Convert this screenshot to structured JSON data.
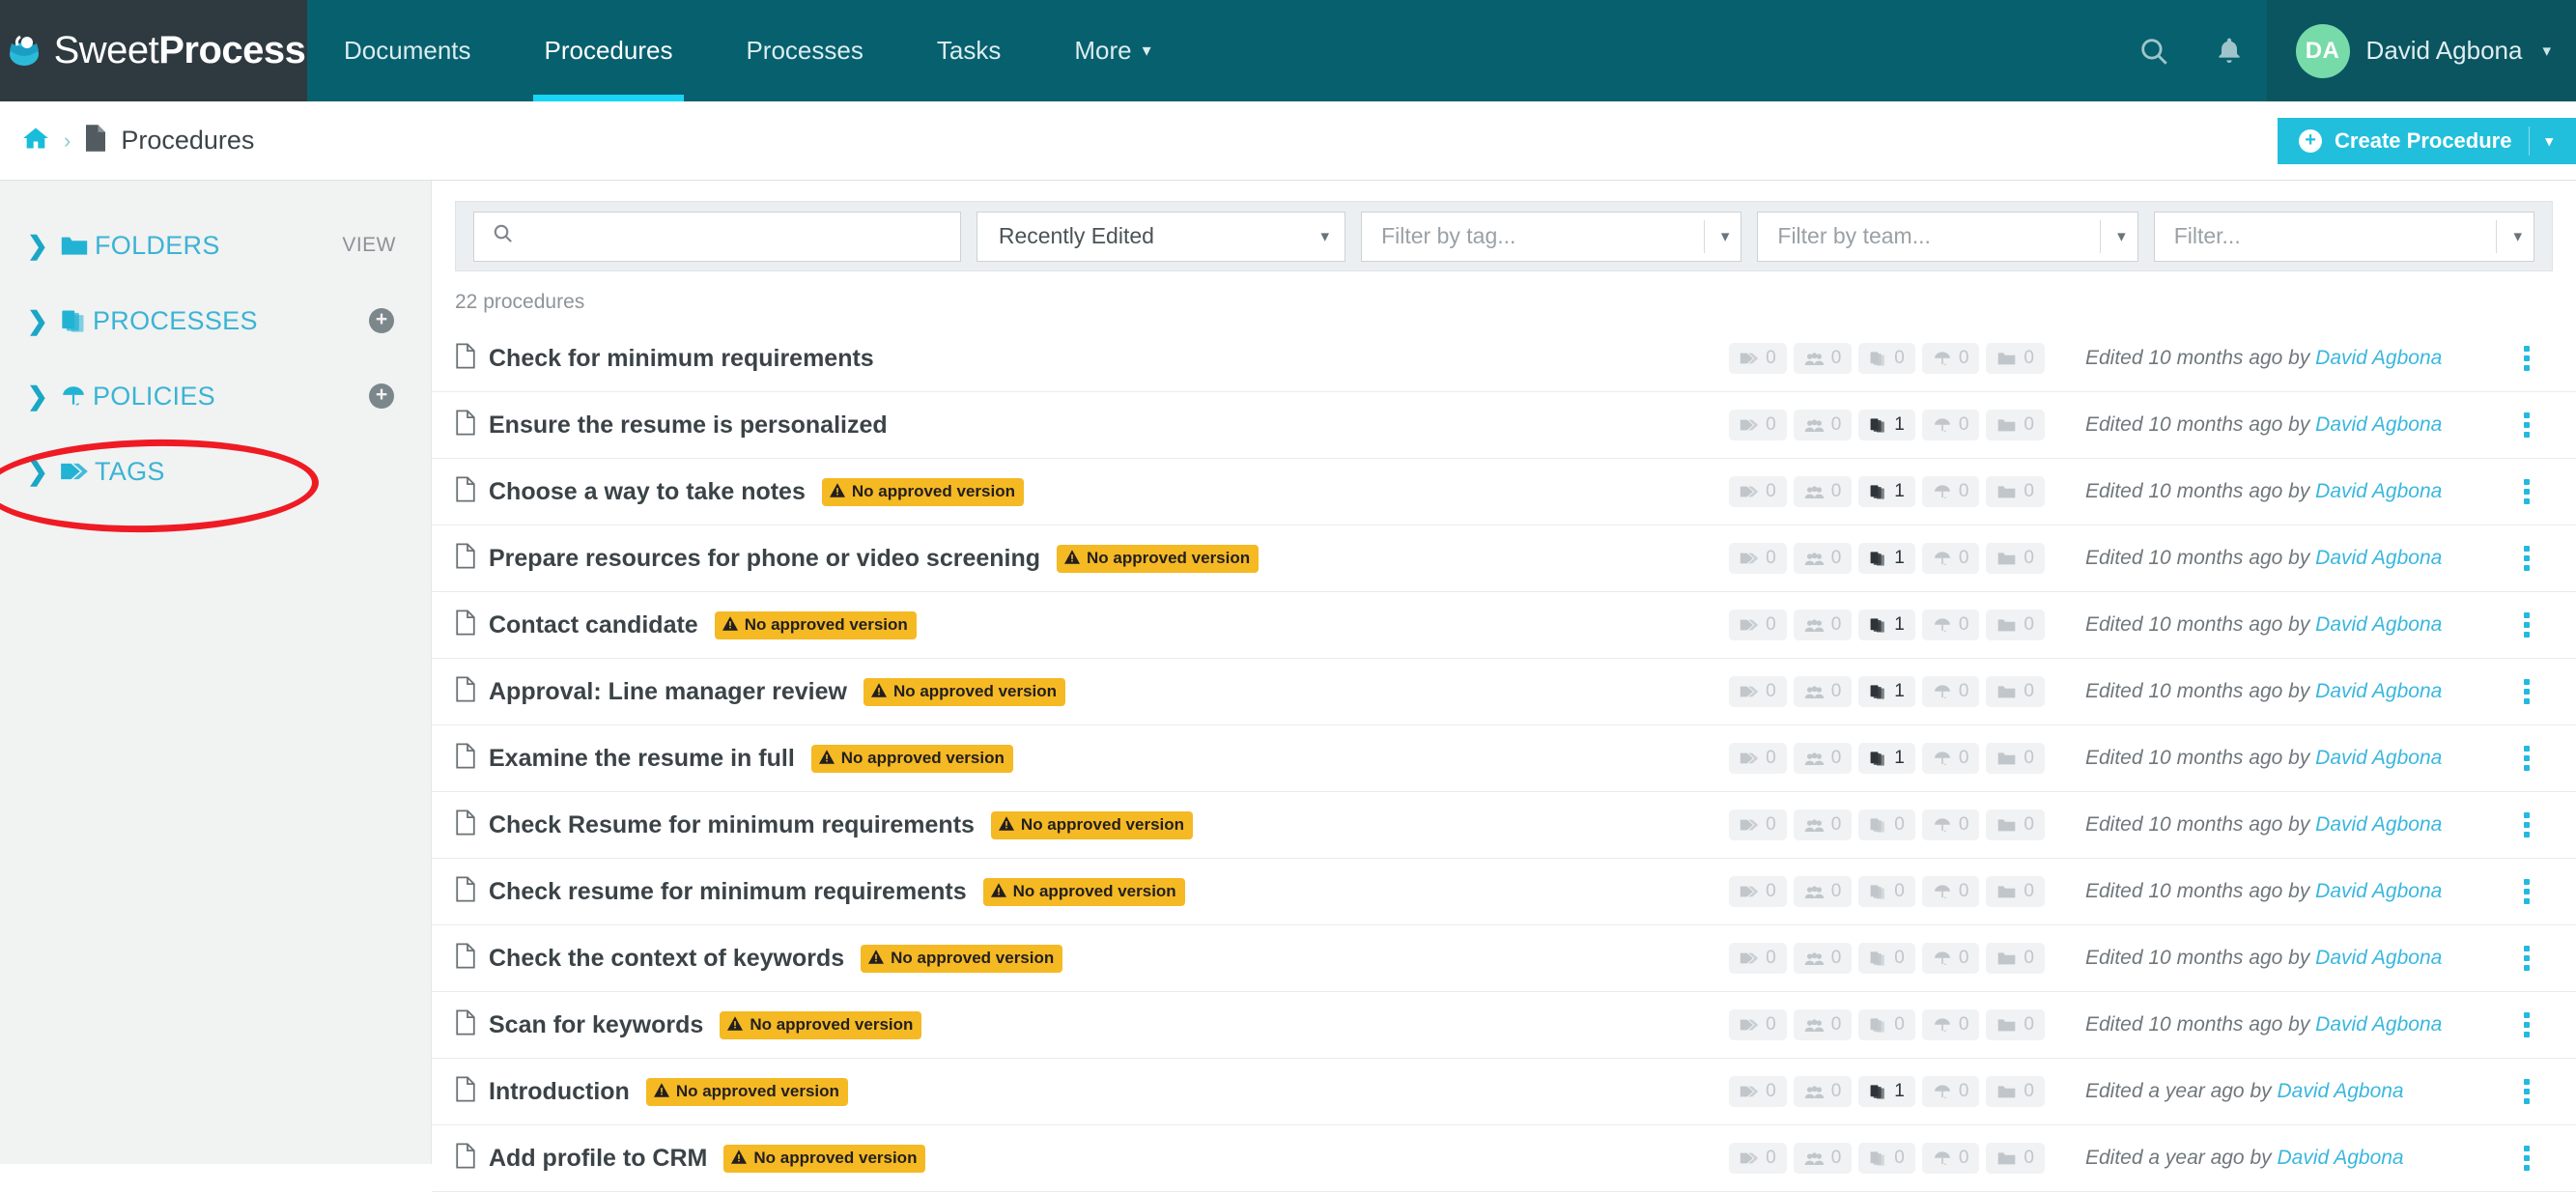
{
  "header": {
    "logo_light": "Sweet",
    "logo_bold": "Process",
    "nav": [
      {
        "label": "Documents",
        "active": false
      },
      {
        "label": "Procedures",
        "active": true
      },
      {
        "label": "Processes",
        "active": false
      },
      {
        "label": "Tasks",
        "active": false
      },
      {
        "label": "More",
        "active": false,
        "caret": "⌄"
      }
    ],
    "search_icon": "search-icon",
    "bell_icon": "bell-icon",
    "user": {
      "initials": "DA",
      "name": "David Agbona",
      "caret": "⌄"
    },
    "accent_teal": "#06606e",
    "accent_cyan": "#19d5f5"
  },
  "breadcrumb": {
    "home_icon": "home-icon",
    "separator": "›",
    "page_icon": "document-icon",
    "label": "Procedures"
  },
  "create_button": {
    "label": "Create Procedure",
    "plus": "+",
    "caret": "▾",
    "color": "#22bfdd"
  },
  "sidebar": {
    "items": [
      {
        "label": "FOLDERS",
        "icon": "folder-icon",
        "action": "VIEW",
        "action_type": "text"
      },
      {
        "label": "PROCESSES",
        "icon": "processes-icon",
        "action": "+",
        "action_type": "plus",
        "annotated": true
      },
      {
        "label": "POLICIES",
        "icon": "umbrella-icon",
        "action": "+",
        "action_type": "plus"
      },
      {
        "label": "TAGS",
        "icon": "tag-icon",
        "action": "",
        "action_type": "none"
      }
    ],
    "annotation_color": "#ee1b24"
  },
  "filters": {
    "search_placeholder": "",
    "search_icon": "search-icon",
    "sort_value": "Recently Edited",
    "tag_placeholder": "Filter by tag...",
    "team_placeholder": "Filter by team...",
    "other_placeholder": "Filter..."
  },
  "list": {
    "count_label": "22 procedures",
    "badge_text": "No approved version",
    "stat_icons": [
      "tag-icon",
      "team-icon",
      "processes-icon",
      "policy-icon",
      "folder-icon"
    ],
    "rows": [
      {
        "name": "Check for minimum requirements",
        "badge": false,
        "stats": [
          0,
          0,
          0,
          0,
          0
        ],
        "edited": "Edited 10 months ago by ",
        "by": "David Agbona"
      },
      {
        "name": "Ensure the resume is personalized",
        "badge": false,
        "stats": [
          0,
          0,
          1,
          0,
          0
        ],
        "edited": "Edited 10 months ago by ",
        "by": "David Agbona"
      },
      {
        "name": "Choose a way to take notes",
        "badge": true,
        "stats": [
          0,
          0,
          1,
          0,
          0
        ],
        "edited": "Edited 10 months ago by ",
        "by": "David Agbona"
      },
      {
        "name": "Prepare resources for phone or video screening",
        "badge": true,
        "stats": [
          0,
          0,
          1,
          0,
          0
        ],
        "edited": "Edited 10 months ago by ",
        "by": "David Agbona"
      },
      {
        "name": "Contact candidate",
        "badge": true,
        "stats": [
          0,
          0,
          1,
          0,
          0
        ],
        "edited": "Edited 10 months ago by ",
        "by": "David Agbona"
      },
      {
        "name": "Approval: Line manager review",
        "badge": true,
        "stats": [
          0,
          0,
          1,
          0,
          0
        ],
        "edited": "Edited 10 months ago by ",
        "by": "David Agbona"
      },
      {
        "name": "Examine the resume in full",
        "badge": true,
        "stats": [
          0,
          0,
          1,
          0,
          0
        ],
        "edited": "Edited 10 months ago by ",
        "by": "David Agbona"
      },
      {
        "name": "Check Resume for minimum requirements",
        "badge": true,
        "stats": [
          0,
          0,
          0,
          0,
          0
        ],
        "edited": "Edited 10 months ago by ",
        "by": "David Agbona"
      },
      {
        "name": "Check resume for minimum requirements",
        "badge": true,
        "stats": [
          0,
          0,
          0,
          0,
          0
        ],
        "edited": "Edited 10 months ago by ",
        "by": "David Agbona"
      },
      {
        "name": "Check the context of keywords",
        "badge": true,
        "stats": [
          0,
          0,
          0,
          0,
          0
        ],
        "edited": "Edited 10 months ago by ",
        "by": "David Agbona"
      },
      {
        "name": "Scan for keywords",
        "badge": true,
        "stats": [
          0,
          0,
          0,
          0,
          0
        ],
        "edited": "Edited 10 months ago by ",
        "by": "David Agbona"
      },
      {
        "name": "Introduction",
        "badge": true,
        "stats": [
          0,
          0,
          1,
          0,
          0
        ],
        "edited": "Edited a year ago by ",
        "by": "David Agbona"
      },
      {
        "name": "Add profile to CRM",
        "badge": true,
        "stats": [
          0,
          0,
          0,
          0,
          0
        ],
        "edited": "Edited a year ago by ",
        "by": "David Agbona"
      }
    ]
  }
}
